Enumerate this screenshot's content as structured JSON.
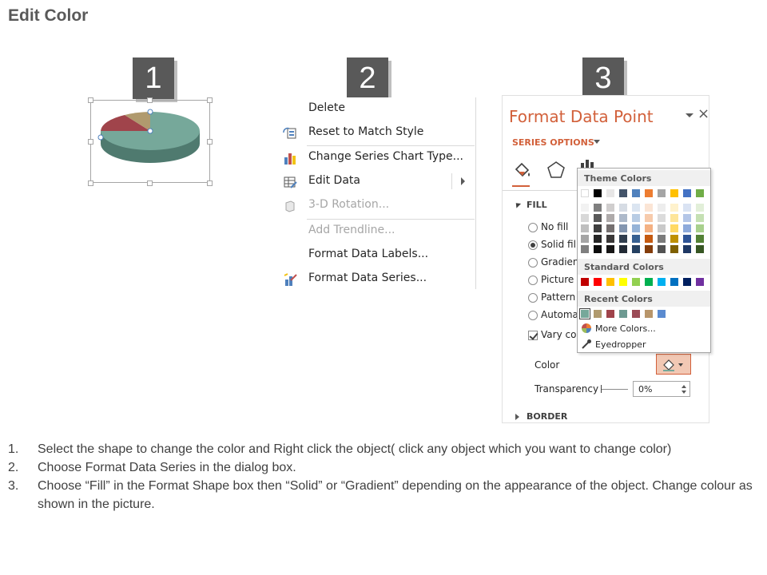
{
  "title": "Edit Color",
  "steps": [
    "1",
    "2",
    "3"
  ],
  "context_menu": {
    "items": [
      {
        "label": "Delete",
        "icon": "none",
        "disabled": false
      },
      {
        "label": "Reset to Match Style",
        "icon": "reset-style-icon",
        "disabled": false
      },
      {
        "label": "Change Series Chart Type...",
        "icon": "chart-type-icon",
        "disabled": false
      },
      {
        "label": "Edit Data",
        "icon": "edit-data-icon",
        "disabled": false,
        "submenu": true
      },
      {
        "label": "3-D Rotation...",
        "icon": "rotation-icon",
        "disabled": true
      },
      {
        "label": "Add Trendline...",
        "icon": "none",
        "disabled": true
      },
      {
        "label": "Format Data Labels...",
        "icon": "none",
        "disabled": false
      },
      {
        "label": "Format Data Series...",
        "icon": "format-series-icon",
        "disabled": false
      }
    ]
  },
  "format_pane": {
    "title": "Format Data Point",
    "close": "×",
    "series_options": "SERIES OPTIONS",
    "fill_section": "FILL",
    "fill_options": [
      {
        "label": "No fill",
        "selected": false
      },
      {
        "label": "Solid fill",
        "selected": true
      },
      {
        "label": "Gradient",
        "selected": false
      },
      {
        "label": "Picture c",
        "selected": false
      },
      {
        "label": "Pattern f",
        "selected": false
      },
      {
        "label": "Automat",
        "selected": false
      }
    ],
    "vary_colors": "Vary colo",
    "color_label": "Color",
    "transparency_label": "Transparency",
    "transparency_value": "0%",
    "border_section": "BORDER",
    "accent_color": "#d2603a"
  },
  "palette": {
    "theme_heading": "Theme Colors",
    "standard_heading": "Standard Colors",
    "recent_heading": "Recent Colors",
    "more_colors": "More Colors...",
    "eyedropper": "Eyedropper",
    "theme_top": [
      "#ffffff",
      "#000000",
      "#e7e6e6",
      "#44546a",
      "#4f81bd",
      "#ed7d31",
      "#a5a5a5",
      "#ffc000",
      "#4472c4",
      "#70ad47"
    ],
    "theme_shades": [
      [
        "#f2f2f2",
        "#7f7f7f",
        "#d0cece",
        "#d6dce4",
        "#dbe5f1",
        "#fbe5d5",
        "#ededed",
        "#fff2cc",
        "#dae3f3",
        "#e2efd9"
      ],
      [
        "#d8d8d8",
        "#595959",
        "#aeaaaa",
        "#adb9ca",
        "#b8cce4",
        "#f7cbac",
        "#dbdbdb",
        "#fee599",
        "#b4c6e7",
        "#c5e0b3"
      ],
      [
        "#bfbfbf",
        "#3f3f3f",
        "#757070",
        "#8496b0",
        "#95b3d7",
        "#f4b183",
        "#c9c9c9",
        "#ffd965",
        "#8eaadb",
        "#a8d08d"
      ],
      [
        "#a5a5a5",
        "#262626",
        "#3a3838",
        "#323f4f",
        "#366092",
        "#c55a11",
        "#7b7b7b",
        "#bf9000",
        "#2f5496",
        "#538135"
      ],
      [
        "#7f7f7f",
        "#0c0c0c",
        "#171616",
        "#222a35",
        "#244061",
        "#833c0b",
        "#525252",
        "#7f6000",
        "#1f3864",
        "#375623"
      ]
    ],
    "standard": [
      "#c00000",
      "#ff0000",
      "#ffc000",
      "#ffff00",
      "#92d050",
      "#00b050",
      "#00b0f0",
      "#0070c0",
      "#002060",
      "#7030a0"
    ],
    "recent": [
      "#76a89a",
      "#b09a6e",
      "#a0444b",
      "#6e9a92",
      "#9b4a56",
      "#b8956a",
      "#5b8bd0"
    ]
  },
  "pie_colors": {
    "main": "#76a89a",
    "red": "#a0444b",
    "tan": "#b09a6e"
  },
  "instructions": [
    {
      "num": "1.",
      "text": "Select the shape to change the color and Right click the object( click any object which you want to change color)"
    },
    {
      "num": "2.",
      "text": "Choose Format Data Series in the dialog box."
    },
    {
      "num": "3.",
      "text": "Choose “Fill” in the Format Shape box then “Solid” or “Gradient” depending on the appearance of the object. Change colour as shown in the picture."
    }
  ]
}
